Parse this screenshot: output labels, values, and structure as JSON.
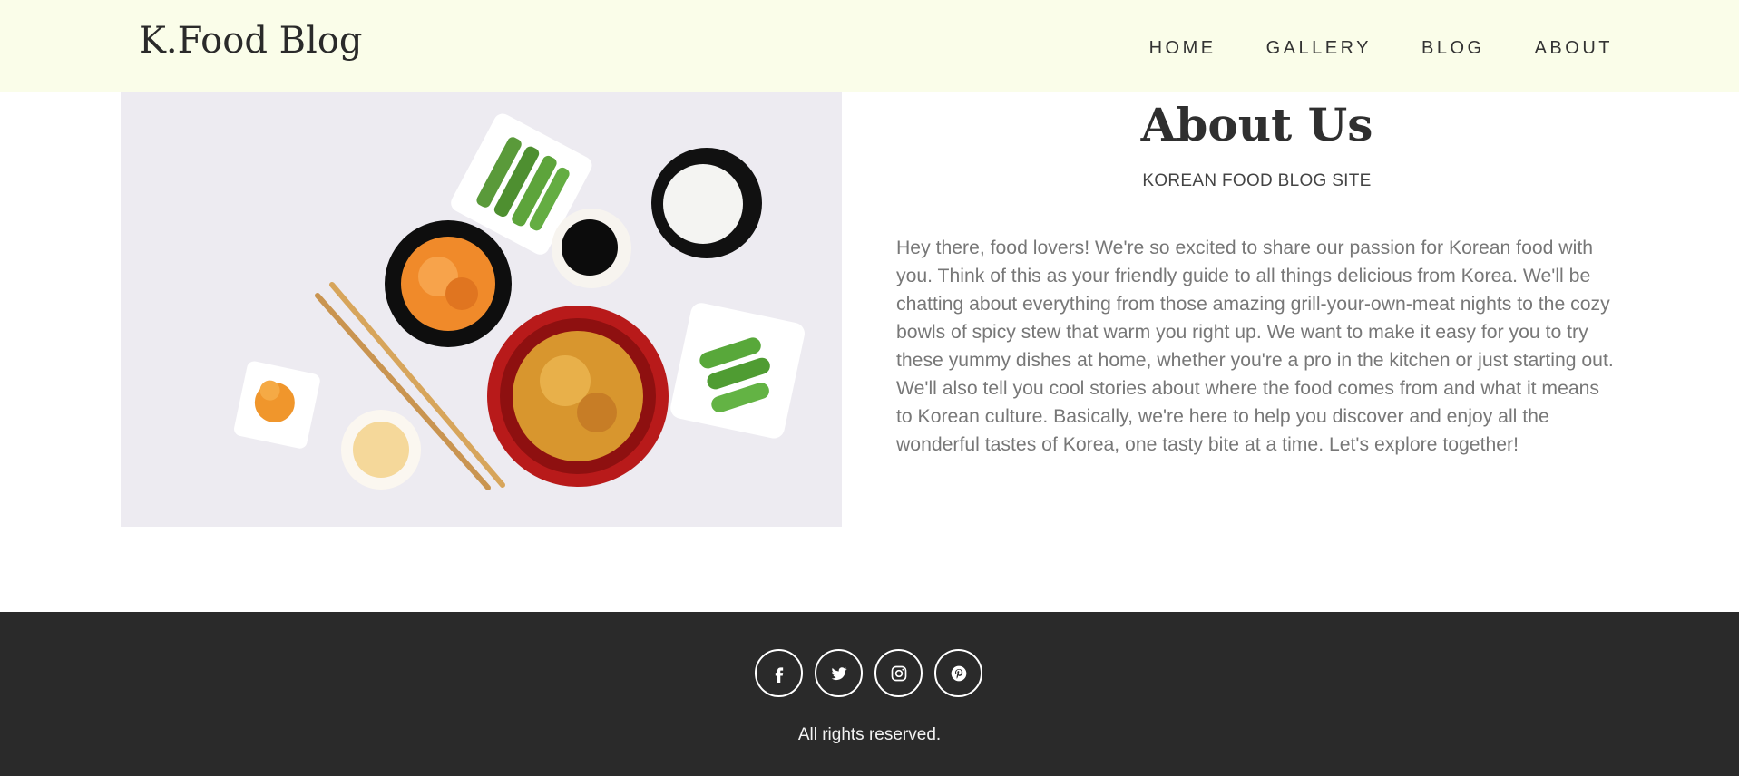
{
  "header": {
    "logo": "K.Food Blog",
    "nav": [
      "HOME",
      "GALLERY",
      "BLOG",
      "ABOUT"
    ]
  },
  "hero_image": {
    "icon": "korean-food-table-photo"
  },
  "about": {
    "title": "About Us",
    "subtitle": "KOREAN FOOD BLOG SITE",
    "text": "Hey there, food lovers! We're so excited to share our passion for Korean food with you. Think of this as your friendly guide to all things delicious from Korea. We'll be chatting about everything from those amazing grill-your-own-meat nights to the cozy bowls of spicy stew that warm you right up. We want to make it easy for you to try these yummy dishes at home, whether you're a pro in the kitchen or just starting out. We'll also tell you cool stories about where the food comes from and what it means to Korean culture. Basically, we're here to help you discover and enjoy all the wonderful tastes of Korea, one tasty bite at a time. Let's explore together!"
  },
  "footer": {
    "socials": [
      "facebook-icon",
      "twitter-icon",
      "instagram-icon",
      "pinterest-icon"
    ],
    "copyright": "All rights reserved."
  },
  "colors": {
    "header_bg": "#fafde8",
    "footer_bg": "#2a2a2a",
    "text_dark": "#2f2f2f",
    "text_body": "#777777"
  }
}
